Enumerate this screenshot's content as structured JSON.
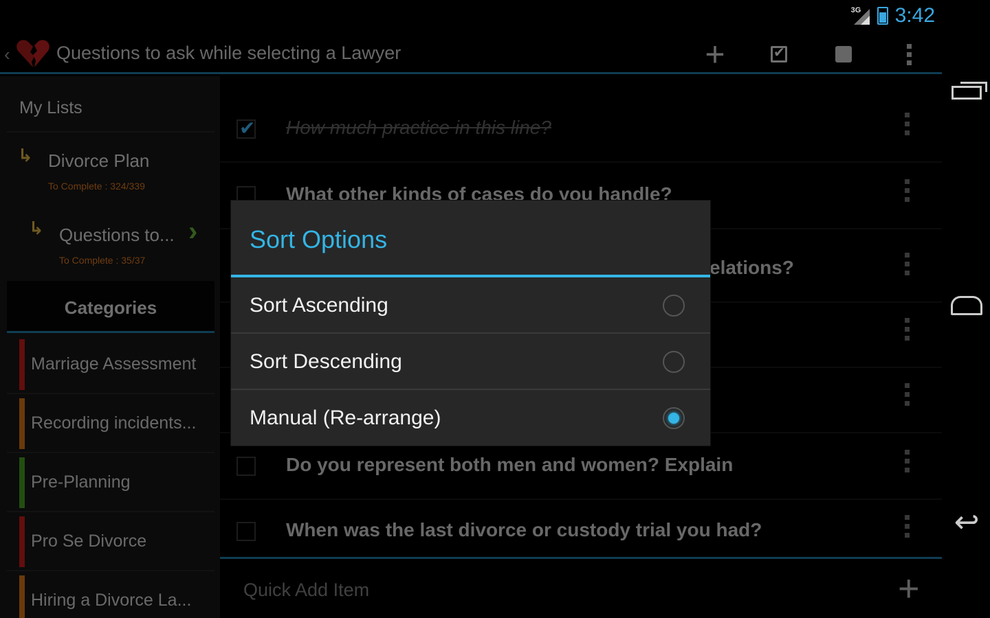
{
  "status": {
    "network": "3G",
    "time": "3:42"
  },
  "action_bar": {
    "title": "Questions to ask while selecting a Lawyer",
    "add_icon": "plus-icon",
    "check_icon": "checkbox-icon",
    "stop_icon": "square-icon",
    "overflow_icon": "overflow-icon"
  },
  "sidebar": {
    "my_lists_label": "My Lists",
    "lists": [
      {
        "name": "Divorce Plan",
        "sub": "To Complete : 324/339"
      },
      {
        "name": "Questions to...",
        "sub": "To Complete : 35/37"
      }
    ],
    "categories_label": "Categories",
    "categories": [
      {
        "label": "Marriage Assessment",
        "color": "#b21a1a"
      },
      {
        "label": "Recording incidents...",
        "color": "#c26a15"
      },
      {
        "label": "Pre-Planning",
        "color": "#3f8f1f"
      },
      {
        "label": "Pro Se Divorce",
        "color": "#b21a1a"
      },
      {
        "label": "Hiring a Divorce La...",
        "color": "#c26a15"
      }
    ]
  },
  "items": [
    {
      "text": "How much practice in this line?",
      "done": true
    },
    {
      "text": "What other kinds of cases do you handle?",
      "done": false
    },
    {
      "text": "elations?",
      "done": false
    },
    {
      "text": "",
      "done": false
    },
    {
      "text": "",
      "done": false
    },
    {
      "text": "Do you represent both men and women? Explain",
      "done": false
    },
    {
      "text": "When was the last divorce or custody trial you had?",
      "done": false
    }
  ],
  "quick_add": {
    "placeholder": "Quick Add Item"
  },
  "dialog": {
    "title": "Sort Options",
    "options": [
      {
        "label": "Sort Ascending",
        "selected": false
      },
      {
        "label": "Sort Descending",
        "selected": false
      },
      {
        "label": "Manual (Re-arrange)",
        "selected": true
      }
    ]
  },
  "colors": {
    "accent": "#33b5e5",
    "divider": "#1d6f97"
  }
}
